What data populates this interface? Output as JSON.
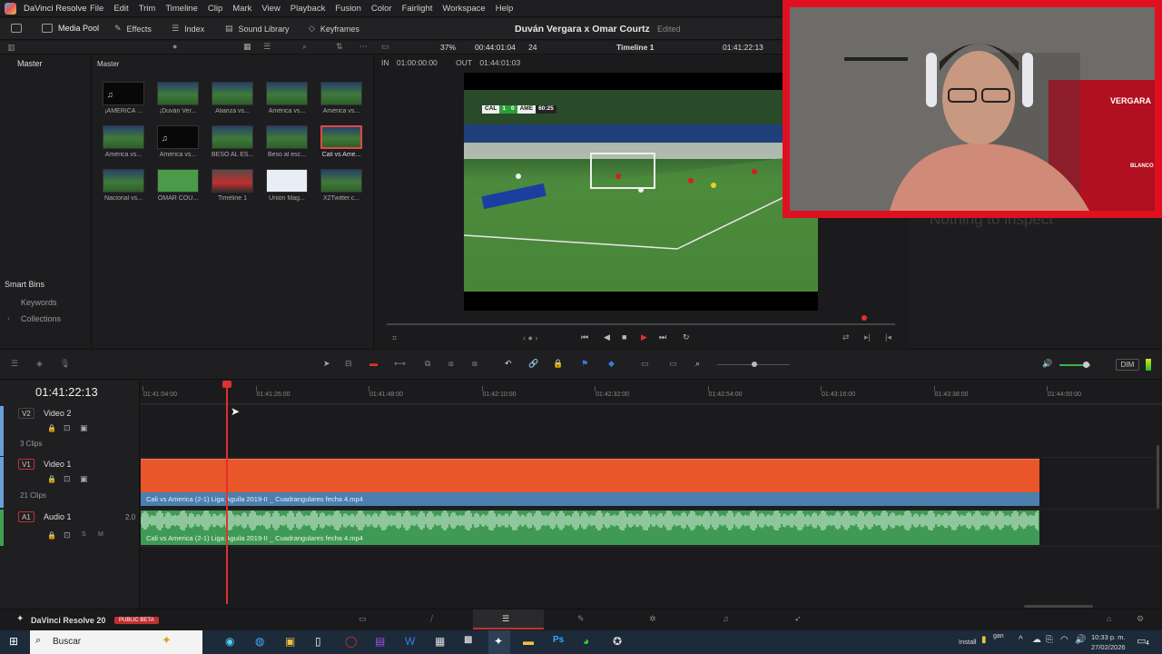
{
  "app": {
    "name": "DaVinci Resolve",
    "footer_name": "DaVinci Resolve 20",
    "badge": "PUBLIC BETA"
  },
  "menu": [
    "File",
    "Edit",
    "Trim",
    "Timeline",
    "Clip",
    "Mark",
    "View",
    "Playback",
    "Fusion",
    "Color",
    "Fairlight",
    "Workspace",
    "Help"
  ],
  "toolbar": {
    "media_pool": "Media Pool",
    "effects": "Effects",
    "index": "Index",
    "sound_library": "Sound Library",
    "keyframes": "Keyframes"
  },
  "project": {
    "title": "Duván Vergara x Omar Courtz",
    "status": "Edited"
  },
  "viewer": {
    "zoom": "37%",
    "timecode": "00:44:01:04",
    "fps": "24",
    "timeline_name": "Timeline 1",
    "current_tc": "01:41:22:13",
    "in_label": "IN",
    "in_tc": "01:00:00:00",
    "out_label": "OUT",
    "out_tc": "01:44:01:03"
  },
  "bins": {
    "master": "Master",
    "smart_bins": "Smart Bins",
    "keywords": "Keywords",
    "collections": "Collections"
  },
  "pool": {
    "header": "Master",
    "clips": [
      {
        "label": "¡AMERICA ...",
        "kind": "audio"
      },
      {
        "label": "¡Duván Ver...",
        "kind": "video"
      },
      {
        "label": "Alianza vs...",
        "kind": "video"
      },
      {
        "label": "América vs...",
        "kind": "video"
      },
      {
        "label": "América vs...",
        "kind": "video"
      },
      {
        "label": "América vs...",
        "kind": "video"
      },
      {
        "label": "América vs...",
        "kind": "audio"
      },
      {
        "label": "BESO AL ES...",
        "kind": "video"
      },
      {
        "label": "Beso al esc...",
        "kind": "video"
      },
      {
        "label": "Cali vs Ame...",
        "kind": "video"
      },
      {
        "label": "Nacional vs...",
        "kind": "video"
      },
      {
        "label": "OMAR COU...",
        "kind": "green"
      },
      {
        "label": "Timeline 1",
        "kind": "timeline"
      },
      {
        "label": "Unión Mag...",
        "kind": "white"
      },
      {
        "label": "X2Twitter.c...",
        "kind": "video"
      }
    ]
  },
  "scoreboard": {
    "home": "CAL",
    "home_score": "1",
    "away_score": "0",
    "away": "AME",
    "clock": "60:25"
  },
  "inspector": {
    "empty": "Nothing to inspect"
  },
  "webcam": {
    "jersey_text": "VERGARA",
    "shirt_brand": "BLANCO"
  },
  "timeline": {
    "timecode": "01:41:22:13",
    "ruler": [
      "01:41:04:00",
      "01:41:26:00",
      "01:41:48:00",
      "01:42:10:00",
      "01:42:32:00",
      "01:42:54:00",
      "01:43:16:00",
      "01:43:38:00",
      "01:44:00:00"
    ],
    "tracks": {
      "v2": {
        "id": "V2",
        "name": "Video 2",
        "clips": "3 Clips"
      },
      "v1": {
        "id": "V1",
        "name": "Video 1",
        "clips": "21 Clips",
        "clip_name": "Cali vs America (2-1) Liga Aguila 2019-II _ Cuadrangulares fecha 4.mp4"
      },
      "a1": {
        "id": "A1",
        "name": "Audio 1",
        "channels": "2.0",
        "clip_name": "Cali vs America (2-1) Liga Aguila 2019-II _ Cuadrangulares fecha 4.mp4"
      }
    },
    "dim": "DIM"
  },
  "taskbar": {
    "search": "Buscar",
    "install": "Install",
    "gan": "gan",
    "time": "10:33 p. m.",
    "date": "27/02/2026",
    "notifications": "4"
  },
  "colors": {
    "video_clip": "#e8562a",
    "audio_clip": "#3f9a55",
    "playhead": "#e03030",
    "webcam_frame": "#e01020"
  }
}
